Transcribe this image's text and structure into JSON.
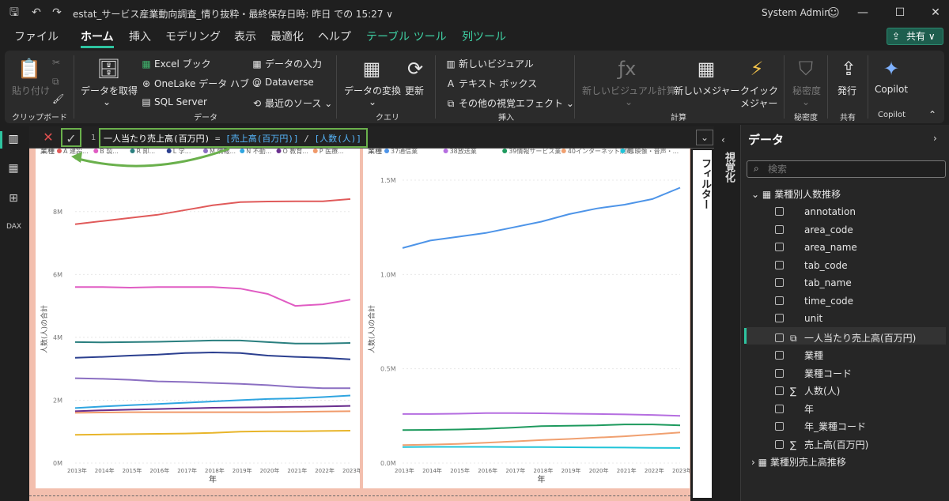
{
  "title": "estat_サービス産業動向調査_情り抜粋・最終保存日時: 昨日 での 15:27 ∨",
  "user": "System Admin",
  "menu": [
    "ファイル",
    "ホーム",
    "挿入",
    "モデリング",
    "表示",
    "最適化",
    "ヘルプ",
    "テーブル ツール",
    "列ツール"
  ],
  "share": "共有",
  "ribbon": {
    "paste": "貼り付け",
    "clipboard": "クリップボード",
    "get_data": "データを取得",
    "excel": "Excel ブック",
    "onelake": "OneLake データ ハブ",
    "sql": "SQL Server",
    "enter_data": "データの入力",
    "dataverse": "Dataverse",
    "recent": "最近のソース",
    "data_group": "データ",
    "transform": "データの変換",
    "refresh": "更新",
    "query_group": "クエリ",
    "new_visual": "新しいビジュアル",
    "textbox": "テキスト ボックス",
    "more_visuals": "その他の視覚エフェクト",
    "insert_group": "挿入",
    "visual_calc": "新しいビジュアル計算",
    "new_measure": "新しいメジャー",
    "quick_measure": "クイック",
    "quick_measure2": "メジャー",
    "calc_group": "計算",
    "sensitivity": "秘密度",
    "sensitivity_group": "秘密度",
    "publish": "発行",
    "share_group": "共有",
    "copilot": "Copilot",
    "copilot_group": "Copilot"
  },
  "formula": {
    "line": "1",
    "name": "一人当たり売上高(百万円)",
    "eq": " = ",
    "ref1": "[売上高(百万円)]",
    "op": " / ",
    "ref2": "[人数(人)]"
  },
  "side_tabs": {
    "viz": "視覚化",
    "filter": "フィルター"
  },
  "data_pane": {
    "title": "データ",
    "search_placeholder": "検索",
    "table1": "業種別人数推移",
    "fields": [
      "annotation",
      "area_code",
      "area_name",
      "tab_code",
      "tab_name",
      "time_code",
      "unit",
      "一人当たり売上高(百万円)",
      "業種",
      "業種コード",
      "人数(人)",
      "年",
      "年_業種コード",
      "売上高(百万円)"
    ],
    "table2": "業種別売上高推移"
  },
  "chart_data": [
    {
      "type": "line",
      "legend_title": "業種",
      "legend": [
        "A 建設...",
        "B 製...",
        "R 卸...",
        "L 学...",
        "M 情報...",
        "N 不動...",
        "O 教育...",
        "P 医療..."
      ],
      "xlabel": "年",
      "ylabel": "人数(人)の合計",
      "x": [
        "2013年",
        "2014年",
        "2015年",
        "2016年",
        "2017年",
        "2018年",
        "2019年",
        "2020年",
        "2021年",
        "2022年",
        "2023年"
      ],
      "yticks": [
        "0M",
        "2M",
        "4M",
        "6M",
        "8M"
      ],
      "ylim": [
        0,
        9000000
      ],
      "series": [
        {
          "color": "#e05a5a",
          "values": [
            7600000,
            7700000,
            7800000,
            7900000,
            8050000,
            8200000,
            8300000,
            8320000,
            8330000,
            8330000,
            8400000
          ]
        },
        {
          "color": "#e05cc3",
          "values": [
            5600000,
            5600000,
            5580000,
            5600000,
            5600000,
            5600000,
            5550000,
            5380000,
            5000000,
            5050000,
            5200000
          ]
        },
        {
          "color": "#2a7f7f",
          "values": [
            3850000,
            3840000,
            3850000,
            3860000,
            3880000,
            3900000,
            3900000,
            3850000,
            3800000,
            3800000,
            3820000
          ]
        },
        {
          "color": "#2b3f8f",
          "values": [
            3350000,
            3380000,
            3420000,
            3450000,
            3500000,
            3520000,
            3500000,
            3420000,
            3380000,
            3350000,
            3300000
          ]
        },
        {
          "color": "#8b6fc2",
          "values": [
            2700000,
            2680000,
            2650000,
            2600000,
            2580000,
            2550000,
            2520000,
            2480000,
            2420000,
            2380000,
            2380000
          ]
        },
        {
          "color": "#2fa5e0",
          "values": [
            1750000,
            1800000,
            1840000,
            1880000,
            1920000,
            1960000,
            2000000,
            2040000,
            2060000,
            2100000,
            2150000
          ]
        },
        {
          "color": "#6a2f8f",
          "values": [
            1650000,
            1680000,
            1700000,
            1720000,
            1740000,
            1760000,
            1770000,
            1780000,
            1790000,
            1800000,
            1820000
          ]
        },
        {
          "color": "#f09a6a",
          "values": [
            1600000,
            1610000,
            1620000,
            1620000,
            1620000,
            1620000,
            1620000,
            1620000,
            1630000,
            1640000,
            1650000
          ]
        },
        {
          "color": "#e8b52a",
          "values": [
            900000,
            910000,
            920000,
            930000,
            940000,
            960000,
            1000000,
            1010000,
            1010000,
            1020000,
            1030000
          ]
        }
      ]
    },
    {
      "type": "line",
      "legend_title": "業種",
      "legend": [
        "37通信業",
        "38放送業",
        "39情報サービス業",
        "40インターネット附随...",
        "41映像・音声・..."
      ],
      "xlabel": "年",
      "ylabel": "人数(人)の合計",
      "x": [
        "2013年",
        "2014年",
        "2015年",
        "2016年",
        "2017年",
        "2018年",
        "2019年",
        "2020年",
        "2021年",
        "2022年",
        "2023年"
      ],
      "yticks": [
        "0.0M",
        "0.5M",
        "1.0M",
        "1.5M"
      ],
      "ylim": [
        0,
        1500000
      ],
      "series": [
        {
          "color": "#4d94e8",
          "values": [
            1140000,
            1180000,
            1200000,
            1220000,
            1250000,
            1280000,
            1320000,
            1350000,
            1370000,
            1400000,
            1460000
          ]
        },
        {
          "color": "#b56ee0",
          "values": [
            260000,
            260000,
            262000,
            265000,
            265000,
            264000,
            262000,
            260000,
            258000,
            255000,
            250000
          ]
        },
        {
          "color": "#1e9a5e",
          "values": [
            175000,
            176000,
            178000,
            182000,
            188000,
            196000,
            198000,
            200000,
            205000,
            205000,
            200000
          ]
        },
        {
          "color": "#f0a070",
          "values": [
            95000,
            98000,
            102000,
            108000,
            115000,
            122000,
            128000,
            135000,
            142000,
            152000,
            162000
          ]
        },
        {
          "color": "#20c4d8",
          "values": [
            85000,
            86000,
            86000,
            86000,
            85000,
            85000,
            84000,
            83000,
            82000,
            81000,
            80000
          ]
        }
      ]
    }
  ]
}
